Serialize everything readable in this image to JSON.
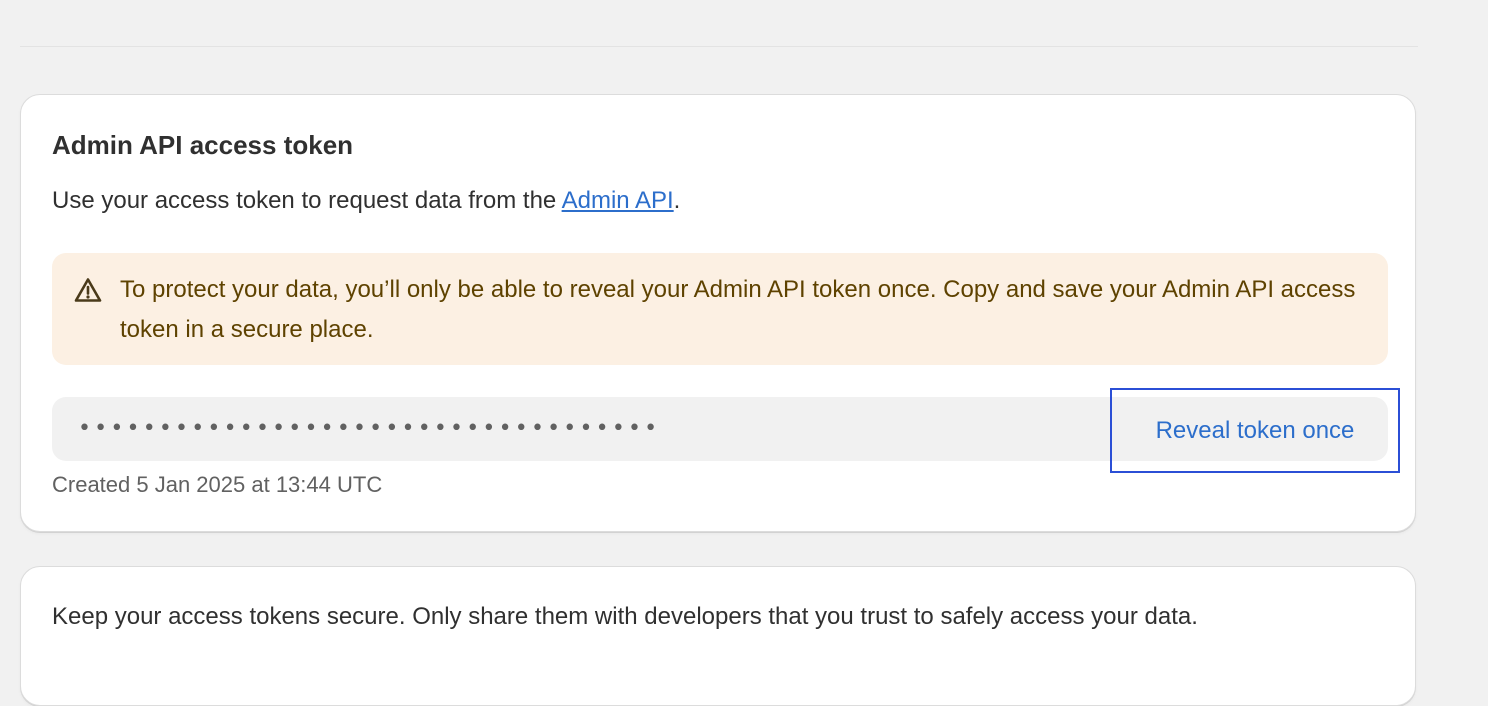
{
  "token_card": {
    "title": "Admin API access token",
    "description_prefix": "Use your access token to request data from the ",
    "description_link": "Admin API",
    "description_suffix": ".",
    "banner": {
      "icon": "warning-triangle-icon",
      "text": "To protect your data, you’ll only be able to reveal your Admin API token once. Copy and save your Admin API access token in a secure place."
    },
    "token_mask": "••••••••••••••••••••••••••••••••••••",
    "reveal_button_label": "Reveal token once",
    "created_text": "Created 5 Jan 2025 at 13:44 UTC"
  },
  "secure_card": {
    "text": "Keep your access tokens secure. Only share them with developers that you trust to safely access your data."
  },
  "colors": {
    "background": "#f1f1f1",
    "link": "#2c6ecb",
    "banner_background": "#fcf0e3",
    "banner_text": "#5e4200",
    "focus_outline": "#2b4fd6"
  }
}
